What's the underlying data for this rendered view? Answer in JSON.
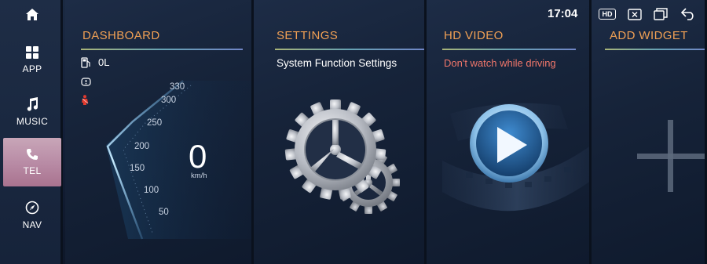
{
  "status_bar": {
    "time": "17:04",
    "hd_badge": "HD",
    "icons": [
      "hd-icon",
      "close-box-icon",
      "windows-icon",
      "back-icon"
    ]
  },
  "sidebar": {
    "home_icon": "home-icon",
    "items": [
      {
        "label": "APP",
        "icon": "grid-icon",
        "active": false
      },
      {
        "label": "MUSIC",
        "icon": "music-note-icon",
        "active": false
      },
      {
        "label": "TEL",
        "icon": "phone-icon",
        "active": true
      },
      {
        "label": "NAV",
        "icon": "compass-icon",
        "active": false
      }
    ]
  },
  "dashboard": {
    "title": "DASHBOARD",
    "fuel": "0L",
    "speed": "0",
    "speed_unit": "km/h",
    "scale": [
      "330",
      "300",
      "250",
      "200",
      "150",
      "100",
      "50"
    ]
  },
  "settings": {
    "title": "SETTINGS",
    "subtitle": "System Function Settings"
  },
  "video": {
    "title": "HD VIDEO",
    "warning": "Don't watch while driving"
  },
  "widget": {
    "title": "ADD WIDGET"
  },
  "colors": {
    "title_orange": "#f1a054",
    "warning_red": "#f0766a",
    "tel_active": "#b98ca6"
  }
}
